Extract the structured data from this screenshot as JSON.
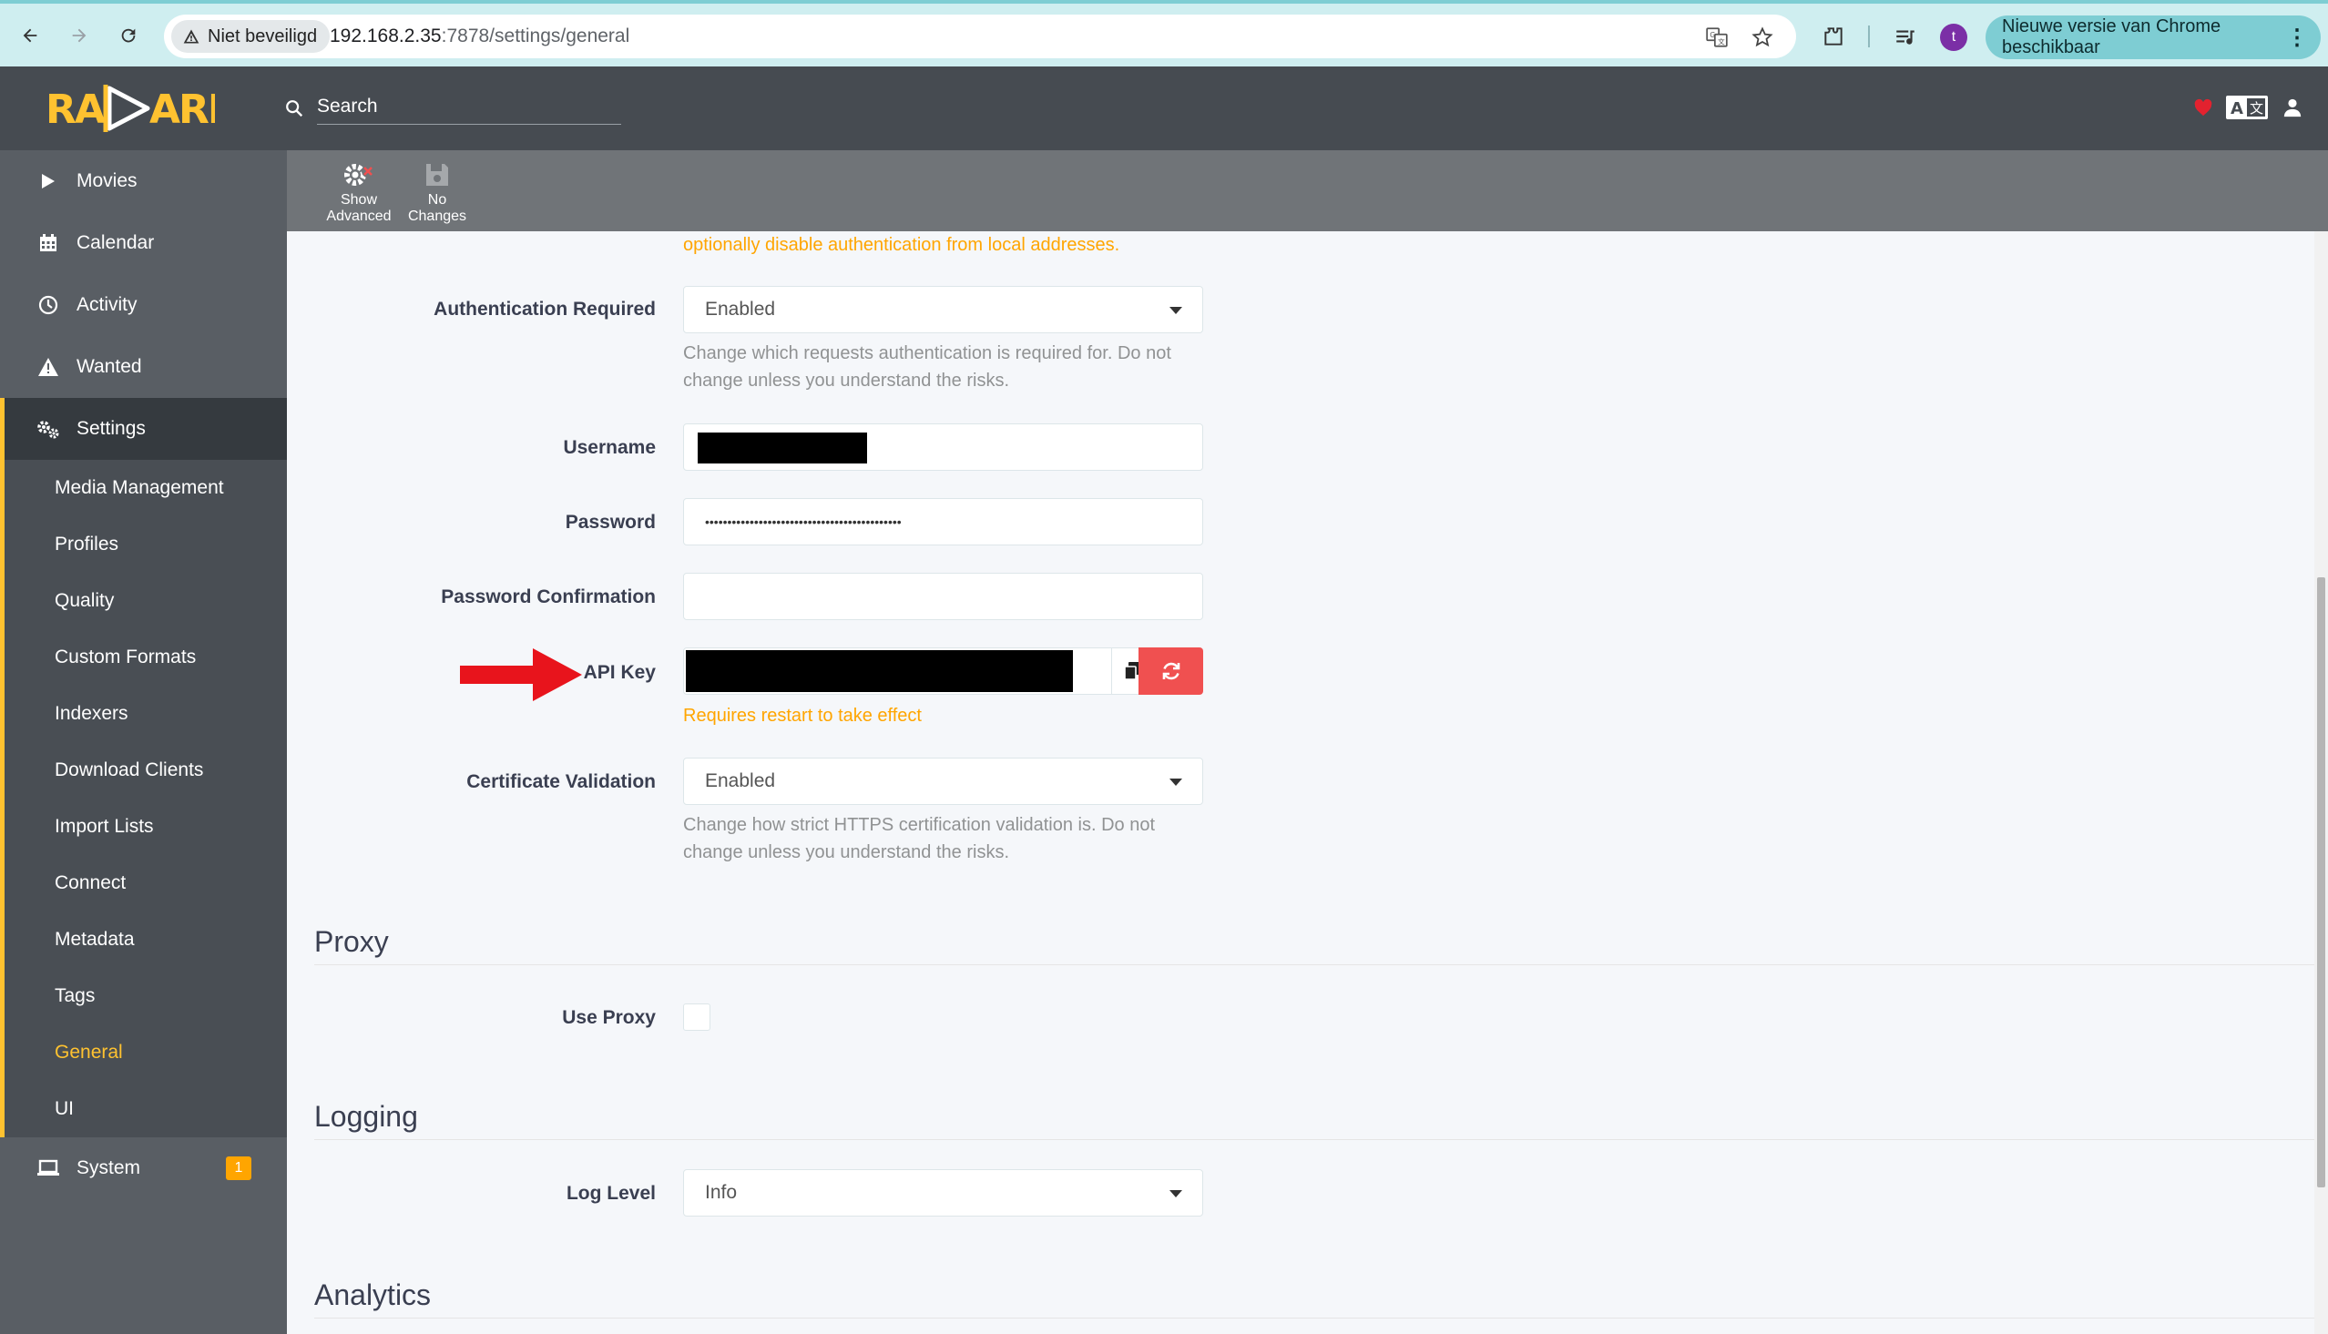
{
  "browser": {
    "security_chip": "Niet beveiligd",
    "url_host": "192.168.2.35",
    "url_path": ":7878/settings/general",
    "profile_initial": "t",
    "update_button": "Nieuwe versie van Chrome beschikbaar"
  },
  "header": {
    "logo_text": "RADARR",
    "search_placeholder": "Search"
  },
  "sidebar": {
    "items": [
      {
        "label": "Movies",
        "icon": "play-icon"
      },
      {
        "label": "Calendar",
        "icon": "calendar-icon"
      },
      {
        "label": "Activity",
        "icon": "clock-icon"
      },
      {
        "label": "Wanted",
        "icon": "warning-icon"
      },
      {
        "label": "Settings",
        "icon": "cogs-icon"
      }
    ],
    "settings_sub": [
      "Media Management",
      "Profiles",
      "Quality",
      "Custom Formats",
      "Indexers",
      "Download Clients",
      "Import Lists",
      "Connect",
      "Metadata",
      "Tags",
      "General",
      "UI"
    ],
    "active_sub": "General",
    "system": {
      "label": "System",
      "icon": "laptop-icon",
      "badge": "1"
    }
  },
  "toolbar": {
    "show_advanced": "Show Advanced",
    "no_changes": "No Changes"
  },
  "form": {
    "auth_note": "optionally disable authentication from local addresses.",
    "auth_required": {
      "label": "Authentication Required",
      "value": "Enabled",
      "help": "Change which requests authentication is required for. Do not change unless you understand the risks."
    },
    "username": {
      "label": "Username"
    },
    "password": {
      "label": "Password",
      "value": "••••••••••••••••••••••••••••••••••••••••••••"
    },
    "password_confirm": {
      "label": "Password Confirmation",
      "value": ""
    },
    "api_key": {
      "label": "API Key",
      "warning": "Requires restart to take effect"
    },
    "cert_validation": {
      "label": "Certificate Validation",
      "value": "Enabled",
      "help": "Change how strict HTTPS certification validation is. Do not change unless you understand the risks."
    }
  },
  "proxy": {
    "title": "Proxy",
    "use_proxy_label": "Use Proxy",
    "use_proxy_checked": false
  },
  "logging": {
    "title": "Logging",
    "log_level_label": "Log Level",
    "log_level_value": "Info"
  },
  "analytics": {
    "title": "Analytics"
  },
  "colors": {
    "accent": "#ffc230",
    "warning": "#ffa500",
    "danger": "#f05050",
    "annotation_arrow": "#e8141c"
  }
}
